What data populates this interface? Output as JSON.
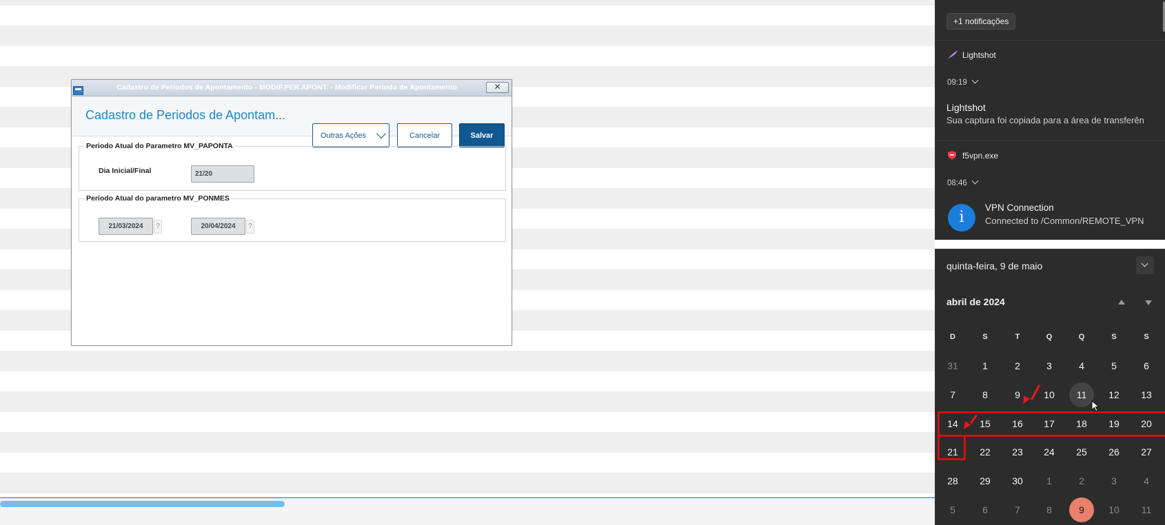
{
  "dialog": {
    "window_title": "Cadastro de Periodos de Apontamento - MODIF.PER.APONT. - Modificar Periodo de Apontamento",
    "close_label": "✕",
    "heading": "Cadastro de Periodos de Apontam...",
    "buttons": {
      "outras": "Outras Ações",
      "cancelar": "Cancelar",
      "salvar": "Salvar"
    },
    "section1": {
      "legend": "Periodo Atual do Parametro MV_PAPONTA",
      "field_label": "Dia Inicial/Final",
      "field_value": "21/20"
    },
    "section2": {
      "legend": "Periodo Atual do parametro MV_PONMES",
      "date_start": "21/03/2024",
      "date_end": "20/04/2024",
      "help": "?"
    }
  },
  "notifications": {
    "more": "+1 notificações",
    "items": [
      {
        "app": "Lightshot",
        "time": "09:19",
        "title": "Lightshot",
        "body": "Sua captura foi copiada para a área de transferên",
        "icon": "feather-icon"
      },
      {
        "app": "f5vpn.exe",
        "time": "08:46",
        "title": "VPN Connection",
        "body": "Connected to /Common/REMOTE_VPN",
        "icon": "shield-icon"
      }
    ],
    "info_icon_glyph": "i"
  },
  "calendar": {
    "date_header": "quinta-feira, 9 de maio",
    "month": "abril de 2024",
    "weekdays": [
      "D",
      "S",
      "T",
      "Q",
      "Q",
      "S",
      "S"
    ],
    "weeks": [
      [
        "31",
        "1",
        "2",
        "3",
        "4",
        "5",
        "6"
      ],
      [
        "7",
        "8",
        "9",
        "10",
        "11",
        "12",
        "13"
      ],
      [
        "14",
        "15",
        "16",
        "17",
        "18",
        "19",
        "20"
      ],
      [
        "21",
        "22",
        "23",
        "24",
        "25",
        "26",
        "27"
      ],
      [
        "28",
        "29",
        "30",
        "1",
        "2",
        "3",
        "4"
      ],
      [
        "5",
        "6",
        "7",
        "8",
        "9",
        "10",
        "11"
      ]
    ],
    "today": "9",
    "colors": {
      "today_bg": "#e8806b",
      "annotation": "#d21010",
      "accent": "#1d87c7"
    }
  }
}
